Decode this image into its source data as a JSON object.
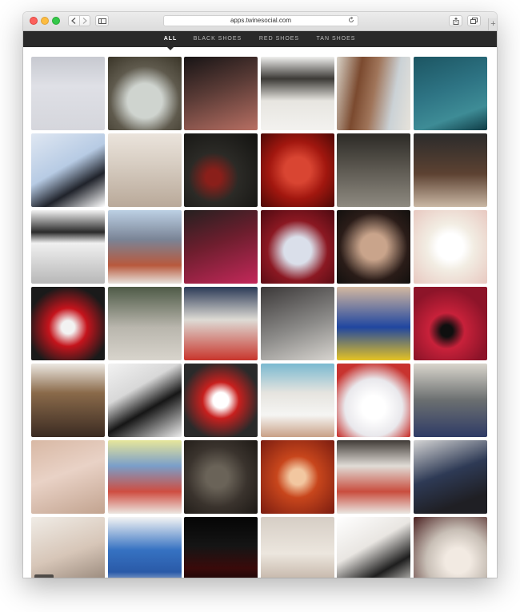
{
  "browser": {
    "url": "apps.twinesocial.com"
  },
  "filters": [
    {
      "label": "ALL",
      "active": true
    },
    {
      "label": "BLACK SHOES",
      "active": false
    },
    {
      "label": "RED SHOES",
      "active": false
    },
    {
      "label": "TAN SHOES",
      "active": false
    }
  ],
  "photo_grid": {
    "columns": 6,
    "rows": 7,
    "photo_count": 42
  },
  "icons": [
    "close-icon",
    "minimize-icon",
    "zoom-icon",
    "back-icon",
    "forward-icon",
    "sidebar-icon",
    "reload-icon",
    "share-icon",
    "tabs-icon",
    "new-tab-icon"
  ],
  "colors": {
    "filter_bar_background": "#2a2a2a",
    "active_filter_text": "#ffffff",
    "inactive_filter_text": "#bdbdbd"
  }
}
